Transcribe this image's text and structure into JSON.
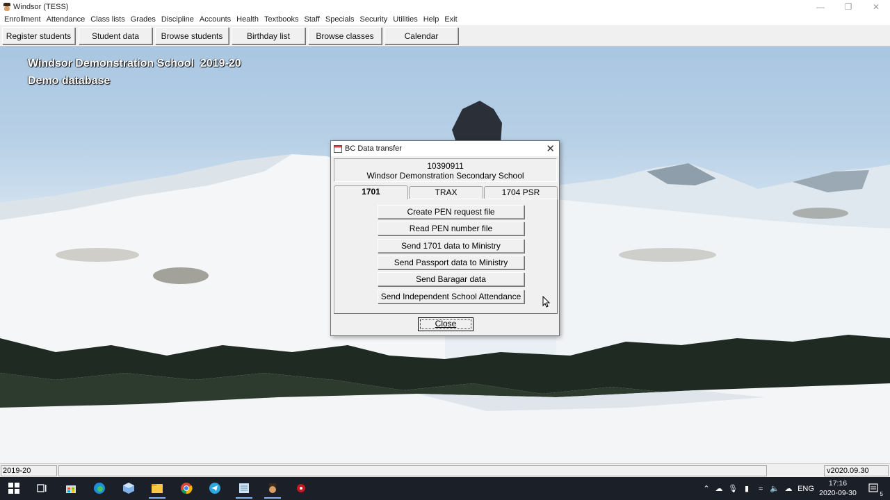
{
  "window": {
    "title": "Windsor (TESS)"
  },
  "menu": [
    "Enrollment",
    "Attendance",
    "Class lists",
    "Grades",
    "Discipline",
    "Accounts",
    "Health",
    "Textbooks",
    "Staff",
    "Specials",
    "Security",
    "Utilities",
    "Help",
    "Exit"
  ],
  "toolbar": {
    "register": "Register students",
    "student_data": "Student data",
    "browse_students": "Browse students",
    "birthday": "Birthday list",
    "browse_classes": "Browse classes",
    "calendar": "Calendar"
  },
  "background": {
    "school": "Windsor Demonstration School  2019-20",
    "database": "Demo database"
  },
  "dialog": {
    "title": "BC Data transfer",
    "school_code": "10390911",
    "school_name": "Windsor Demonstration Secondary School",
    "tabs": [
      "1701",
      "TRAX",
      "1704 PSR"
    ],
    "active_tab": "1701",
    "buttons": [
      "Create PEN request file",
      "Read PEN number file",
      "Send 1701 data to Ministry",
      "Send Passport data to Ministry",
      "Send Baragar data",
      "Send Independent School Attendance"
    ],
    "close": "Close"
  },
  "statusbar": {
    "year": "2019-20",
    "version": "v2020.09.30"
  },
  "taskbar": {
    "lang": "ENG",
    "time": "17:16",
    "date": "2020-09-30",
    "notifications": "5"
  },
  "colors": {
    "taskbar": "#1b1f27",
    "dialog_bg": "#f0f0f0",
    "sky": "#a9c6e2"
  }
}
